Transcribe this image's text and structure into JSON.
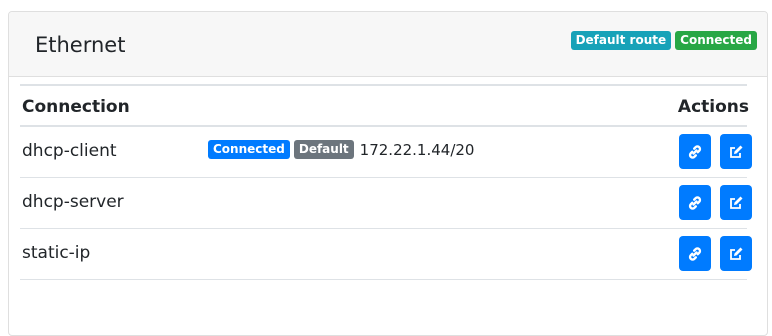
{
  "card": {
    "title": "Ethernet",
    "badges": [
      {
        "label": "Default route",
        "color": "#17a2b8"
      },
      {
        "label": "Connected",
        "color": "#28a745"
      }
    ]
  },
  "table": {
    "headers": {
      "connection": "Connection",
      "actions": "Actions"
    },
    "rows": [
      {
        "name": "dhcp-client",
        "badges": [
          {
            "label": "Connected",
            "color": "#007bff"
          },
          {
            "label": "Default",
            "color": "#6c757d"
          }
        ],
        "ip": "172.22.1.44/20",
        "actions": [
          "link-icon",
          "edit-icon"
        ]
      },
      {
        "name": "dhcp-server",
        "badges": [],
        "ip": "",
        "actions": [
          "link-icon",
          "edit-icon"
        ]
      },
      {
        "name": "static-ip",
        "badges": [],
        "ip": "",
        "actions": [
          "link-icon",
          "edit-icon"
        ]
      }
    ]
  },
  "colors": {
    "primary": "#007bff",
    "header_bg": "#f7f7f7",
    "border": "#dee2e6"
  }
}
